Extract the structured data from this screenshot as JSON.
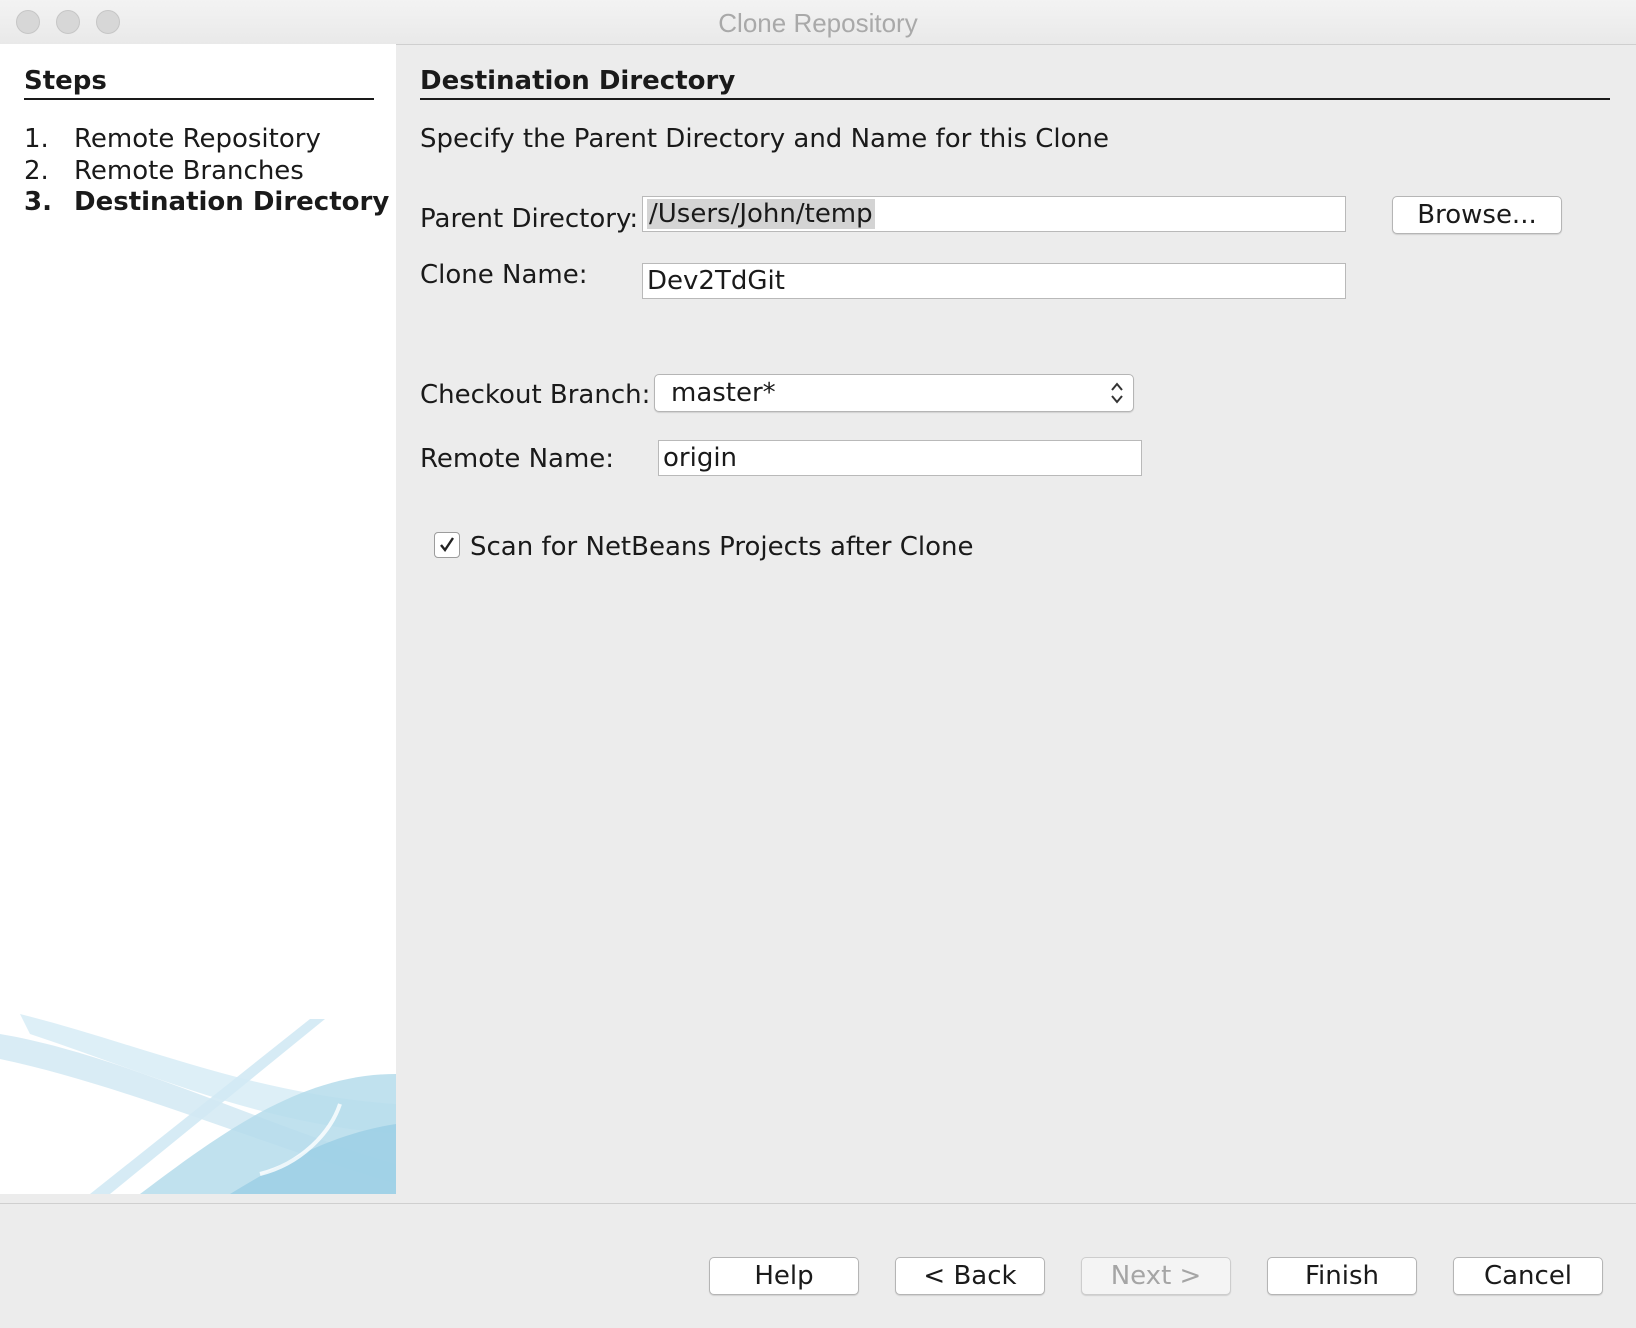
{
  "window": {
    "title": "Clone Repository"
  },
  "steps": {
    "heading": "Steps",
    "items": [
      {
        "num": "1.",
        "label": "Remote Repository"
      },
      {
        "num": "2.",
        "label": "Remote Branches"
      },
      {
        "num": "3.",
        "label": "Destination Directory"
      }
    ]
  },
  "content": {
    "heading": "Destination Directory",
    "subtitle": "Specify the Parent Directory and Name for this Clone",
    "parent_directory": {
      "label": "Parent Directory:",
      "value": "/Users/John/temp",
      "browse_label": "Browse..."
    },
    "clone_name": {
      "label": "Clone Name:",
      "value": "Dev2TdGit"
    },
    "checkout_branch": {
      "label": "Checkout Branch:",
      "value": "master*"
    },
    "remote_name": {
      "label": "Remote Name:",
      "value": "origin"
    },
    "scan_checkbox": {
      "label": "Scan for NetBeans Projects after Clone",
      "checked": true
    }
  },
  "buttons": {
    "help": "Help",
    "back": "< Back",
    "next": "Next >",
    "finish": "Finish",
    "cancel": "Cancel"
  },
  "colors": {
    "window_bg": "#ececec",
    "steps_bg": "#ffffff",
    "swoosh": "#9fd0e6"
  }
}
